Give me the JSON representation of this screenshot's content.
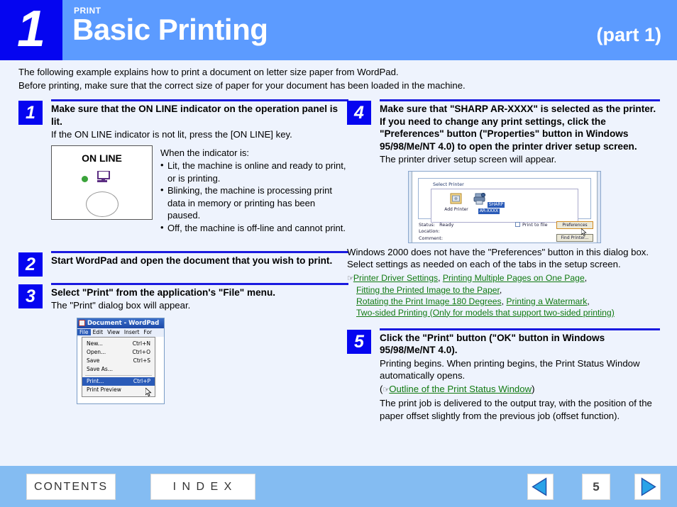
{
  "header": {
    "chapter_number": "1",
    "kicker": "PRINT",
    "title": "Basic Printing",
    "part": "(part 1)",
    "accent_dark": "#0505f0",
    "accent_bar": "#5c9bff"
  },
  "intro": {
    "line1": "The following example explains how to print a document on letter size paper from WordPad.",
    "line2": "Before printing, make sure that the correct size of paper for your document has been loaded in the machine."
  },
  "steps": [
    {
      "number": "1",
      "heading": "Make sure that the ON LINE indicator on the operation panel is lit.",
      "text": "If the ON LINE indicator is not lit, press the [ON LINE] key."
    },
    {
      "number": "2",
      "heading": "Start WordPad and open the document that you wish to print.",
      "text": ""
    },
    {
      "number": "3",
      "heading": "Select \"Print\" from the application's \"File\" menu.",
      "text": "The \"Print\" dialog box will appear."
    },
    {
      "number": "4",
      "heading": "Make sure that \"SHARP AR-XXXX\" is selected as the printer. If you need to change any print settings, click the \"Preferences\" button (\"Properties\" button in Windows 95/98/Me/NT 4.0) to open the printer driver setup screen.",
      "text": "The printer driver setup screen will appear."
    },
    {
      "number": "5",
      "heading": "Click the \"Print\" button (\"OK\" button in Windows 95/98/Me/NT 4.0).",
      "text": "Printing begins. When printing begins, the Print Status Window automatically opens."
    }
  ],
  "online_panel": {
    "label": "ON LINE",
    "indicator_color": "#3aa33a",
    "icon": "monitor-icon"
  },
  "indicator_list": {
    "lead": "When the indicator is:",
    "items": [
      "Lit, the machine is online and ready to print, or is printing.",
      "Blinking, the machine is processing print data in memory or printing has been paused.",
      "Off, the machine is off-line and cannot print."
    ]
  },
  "wordpad": {
    "title": "Document - WordPad",
    "menubar": [
      "File",
      "Edit",
      "View",
      "Insert",
      "For"
    ],
    "menu_items": [
      {
        "label": "New...",
        "shortcut": "Ctrl+N"
      },
      {
        "label": "Open...",
        "shortcut": "Ctrl+O"
      },
      {
        "label": "Save",
        "shortcut": "Ctrl+S"
      },
      {
        "label": "Save As...",
        "shortcut": ""
      },
      {
        "label": "Print...",
        "shortcut": "Ctrl+P"
      },
      {
        "label": "Print Preview",
        "shortcut": ""
      }
    ]
  },
  "print_dialog": {
    "group_title": "Select Printer",
    "add_printer": "Add Printer",
    "printer_name_line1": "SHARP",
    "printer_name_line2": "AR-XXXX",
    "status_label": "Status:",
    "status_value": "Ready",
    "location_label": "Location:",
    "comment_label": "Comment:",
    "print_to_file": "Print to file",
    "preferences_button": "Preferences",
    "find_printer_button": "Find Printer..."
  },
  "step4_note": {
    "text": "Windows 2000 does not have the \"Preferences\" button in this dialog box. Select settings as needed on each of the tabs in the setup screen.",
    "pointer": "☞",
    "links": [
      "Printer Driver Settings",
      "Printing Multiple Pages on One Page",
      "Fitting the Printed Image to the Paper",
      "Rotating the Print Image 180 Degrees",
      "Printing a Watermark",
      "Two-sided Printing (Only for models that support two-sided printing)"
    ],
    "link_color": "#117a11"
  },
  "step5_extra": {
    "pointer": "☞",
    "link": "Outline of the Print Status Window",
    "tail": "The print job is delivered to the output tray, with the position of the paper offset slightly from the previous job (offset function)."
  },
  "footer": {
    "contents": "CONTENTS",
    "index": "I N D E X",
    "page": "5",
    "prev_icon": "previous-page-arrow",
    "next_icon": "next-page-arrow",
    "background": "#84bcf2"
  }
}
